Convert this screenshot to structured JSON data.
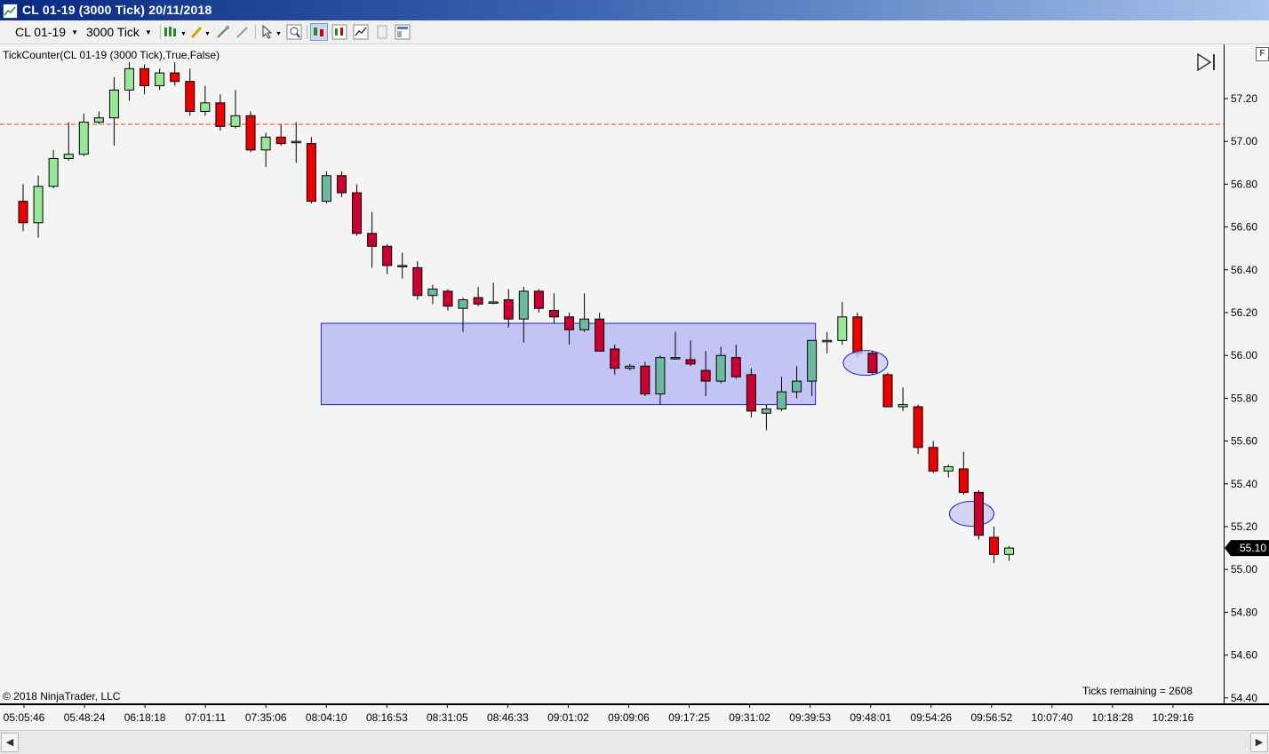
{
  "window": {
    "title": "CL 01-19 (3000 Tick)  20/11/2018"
  },
  "toolbar": {
    "instrument": "CL 01-19",
    "interval": "3000 Tick"
  },
  "indicator_label": "TickCounter(CL 01-19 (3000 Tick),True,False)",
  "copyright": "© 2018 NinjaTrader, LLC",
  "ticks_remaining": "Ticks remaining = 2608",
  "f_button": "F",
  "colors": {
    "up": "#98e898",
    "up_in_zone": "#6cb8a0",
    "down": "#ee0000",
    "down_in_zone": "#cc0030",
    "zone_fill": "#c4c4f4",
    "zone_border": "#2020c0",
    "ellipse": "#c8c8f4",
    "hline": "#ff7a40",
    "background": "#f4f4f4"
  },
  "chart_data": {
    "type": "candlestick",
    "x_labels": [
      "05:05:46",
      "05:48:24",
      "06:18:18",
      "07:01:11",
      "07:35:06",
      "08:04:10",
      "08:16:53",
      "08:31:05",
      "08:46:33",
      "09:01:02",
      "09:09:06",
      "09:17:25",
      "09:31:02",
      "09:39:53",
      "09:48:01",
      "09:54:26",
      "09:56:52",
      "10:07:40",
      "10:18:28",
      "10:29:16"
    ],
    "y_ticks": [
      "57.20",
      "57.00",
      "56.80",
      "56.60",
      "56.40",
      "56.20",
      "56.00",
      "55.80",
      "55.60",
      "55.40",
      "55.20",
      "55.00",
      "54.80",
      "54.60",
      "54.40"
    ],
    "ylim": [
      54.38,
      57.37
    ],
    "last_price": "55.10",
    "horizontal_line": 57.08,
    "zone": {
      "top": 56.15,
      "bottom": 55.77,
      "from_bar": 20,
      "to_bar": 52
    },
    "marked_bars": [
      56,
      63
    ],
    "candles": [
      {
        "o": 56.72,
        "h": 56.8,
        "l": 56.58,
        "c": 56.62
      },
      {
        "o": 56.62,
        "h": 56.84,
        "l": 56.55,
        "c": 56.79
      },
      {
        "o": 56.79,
        "h": 56.96,
        "l": 56.78,
        "c": 56.92
      },
      {
        "o": 56.92,
        "h": 57.09,
        "l": 56.91,
        "c": 56.94
      },
      {
        "o": 56.94,
        "h": 57.13,
        "l": 56.93,
        "c": 57.09
      },
      {
        "o": 57.09,
        "h": 57.14,
        "l": 57.08,
        "c": 57.11
      },
      {
        "o": 57.11,
        "h": 57.3,
        "l": 56.98,
        "c": 57.24
      },
      {
        "o": 57.24,
        "h": 57.37,
        "l": 57.19,
        "c": 57.34
      },
      {
        "o": 57.34,
        "h": 57.36,
        "l": 57.22,
        "c": 57.26
      },
      {
        "o": 57.26,
        "h": 57.34,
        "l": 57.24,
        "c": 57.32
      },
      {
        "o": 57.32,
        "h": 57.37,
        "l": 57.26,
        "c": 57.28
      },
      {
        "o": 57.28,
        "h": 57.34,
        "l": 57.12,
        "c": 57.14
      },
      {
        "o": 57.14,
        "h": 57.26,
        "l": 57.12,
        "c": 57.18
      },
      {
        "o": 57.18,
        "h": 57.22,
        "l": 57.05,
        "c": 57.07
      },
      {
        "o": 57.07,
        "h": 57.24,
        "l": 57.06,
        "c": 57.12
      },
      {
        "o": 57.12,
        "h": 57.14,
        "l": 56.95,
        "c": 56.96
      },
      {
        "o": 56.96,
        "h": 57.04,
        "l": 56.88,
        "c": 57.02
      },
      {
        "o": 57.02,
        "h": 57.08,
        "l": 56.98,
        "c": 56.99
      },
      {
        "o": 57.0,
        "h": 57.09,
        "l": 56.9,
        "c": 57.0
      },
      {
        "o": 56.99,
        "h": 57.02,
        "l": 56.71,
        "c": 56.72
      },
      {
        "o": 56.72,
        "h": 56.86,
        "l": 56.71,
        "c": 56.84
      },
      {
        "o": 56.84,
        "h": 56.86,
        "l": 56.74,
        "c": 56.76
      },
      {
        "o": 56.76,
        "h": 56.8,
        "l": 56.56,
        "c": 56.57
      },
      {
        "o": 56.57,
        "h": 56.67,
        "l": 56.41,
        "c": 56.51
      },
      {
        "o": 56.51,
        "h": 56.52,
        "l": 56.38,
        "c": 56.42
      },
      {
        "o": 56.42,
        "h": 56.48,
        "l": 56.36,
        "c": 56.42
      },
      {
        "o": 56.41,
        "h": 56.44,
        "l": 56.26,
        "c": 56.28
      },
      {
        "o": 56.28,
        "h": 56.33,
        "l": 56.24,
        "c": 56.31
      },
      {
        "o": 56.3,
        "h": 56.31,
        "l": 56.21,
        "c": 56.23
      },
      {
        "o": 56.22,
        "h": 56.27,
        "l": 56.11,
        "c": 56.26
      },
      {
        "o": 56.27,
        "h": 56.32,
        "l": 56.23,
        "c": 56.24
      },
      {
        "o": 56.25,
        "h": 56.34,
        "l": 56.24,
        "c": 56.25
      },
      {
        "o": 56.26,
        "h": 56.31,
        "l": 56.13,
        "c": 56.17
      },
      {
        "o": 56.17,
        "h": 56.32,
        "l": 56.06,
        "c": 56.3
      },
      {
        "o": 56.3,
        "h": 56.31,
        "l": 56.2,
        "c": 56.22
      },
      {
        "o": 56.21,
        "h": 56.29,
        "l": 56.15,
        "c": 56.18
      },
      {
        "o": 56.18,
        "h": 56.2,
        "l": 56.05,
        "c": 56.12
      },
      {
        "o": 56.12,
        "h": 56.29,
        "l": 56.11,
        "c": 56.17
      },
      {
        "o": 56.17,
        "h": 56.2,
        "l": 56.02,
        "c": 56.02
      },
      {
        "o": 56.03,
        "h": 56.05,
        "l": 55.91,
        "c": 55.94
      },
      {
        "o": 55.94,
        "h": 55.96,
        "l": 55.93,
        "c": 55.95
      },
      {
        "o": 55.95,
        "h": 55.97,
        "l": 55.81,
        "c": 55.82
      },
      {
        "o": 55.82,
        "h": 56.0,
        "l": 55.77,
        "c": 55.99
      },
      {
        "o": 55.99,
        "h": 56.11,
        "l": 55.98,
        "c": 55.99
      },
      {
        "o": 55.98,
        "h": 56.07,
        "l": 55.95,
        "c": 55.96
      },
      {
        "o": 55.93,
        "h": 56.02,
        "l": 55.81,
        "c": 55.88
      },
      {
        "o": 55.88,
        "h": 56.04,
        "l": 55.87,
        "c": 56.0
      },
      {
        "o": 55.99,
        "h": 56.05,
        "l": 55.89,
        "c": 55.9
      },
      {
        "o": 55.91,
        "h": 55.94,
        "l": 55.71,
        "c": 55.74
      },
      {
        "o": 55.73,
        "h": 55.77,
        "l": 55.65,
        "c": 55.75
      },
      {
        "o": 55.75,
        "h": 55.9,
        "l": 55.74,
        "c": 55.83
      },
      {
        "o": 55.83,
        "h": 55.95,
        "l": 55.8,
        "c": 55.88
      },
      {
        "o": 55.88,
        "h": 56.07,
        "l": 55.81,
        "c": 56.07
      },
      {
        "o": 56.07,
        "h": 56.11,
        "l": 56.01,
        "c": 56.07
      },
      {
        "o": 56.07,
        "h": 56.25,
        "l": 56.05,
        "c": 56.18
      },
      {
        "o": 56.18,
        "h": 56.2,
        "l": 55.99,
        "c": 56.01
      },
      {
        "o": 56.01,
        "h": 56.02,
        "l": 55.91,
        "c": 55.92
      },
      {
        "o": 55.91,
        "h": 55.92,
        "l": 55.76,
        "c": 55.76
      },
      {
        "o": 55.76,
        "h": 55.85,
        "l": 55.74,
        "c": 55.77
      },
      {
        "o": 55.76,
        "h": 55.77,
        "l": 55.54,
        "c": 55.57
      },
      {
        "o": 55.57,
        "h": 55.6,
        "l": 55.45,
        "c": 55.46
      },
      {
        "o": 55.46,
        "h": 55.49,
        "l": 55.43,
        "c": 55.48
      },
      {
        "o": 55.47,
        "h": 55.55,
        "l": 55.35,
        "c": 55.36
      },
      {
        "o": 55.36,
        "h": 55.37,
        "l": 55.14,
        "c": 55.16
      },
      {
        "o": 55.15,
        "h": 55.2,
        "l": 55.03,
        "c": 55.07
      },
      {
        "o": 55.07,
        "h": 55.11,
        "l": 55.04,
        "c": 55.1
      }
    ]
  }
}
